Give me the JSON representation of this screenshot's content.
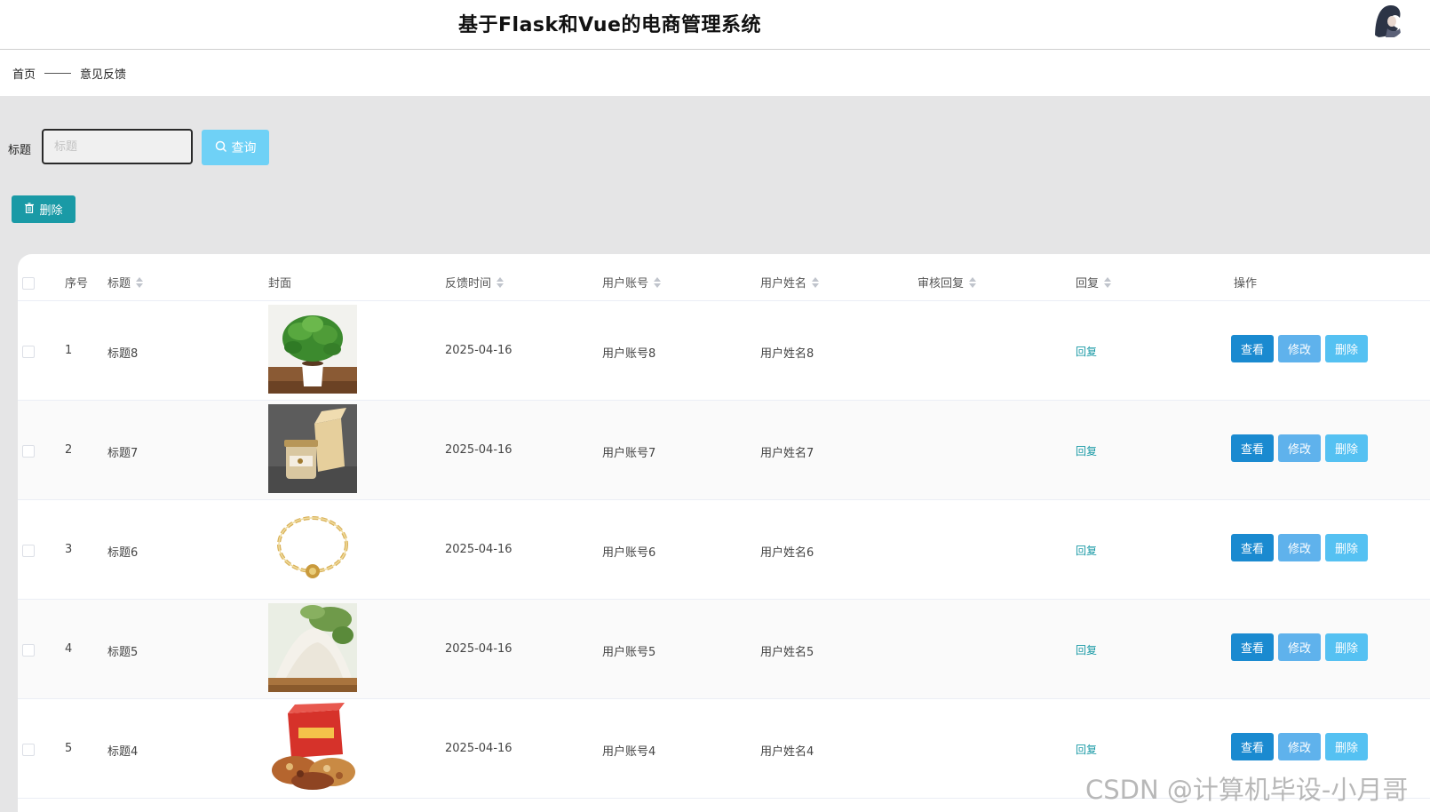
{
  "header": {
    "title": "基于Flask和Vue的电商管理系统",
    "avatar_icon": "user-avatar"
  },
  "breadcrumb": {
    "home": "首页",
    "current": "意见反馈"
  },
  "search": {
    "label": "标题",
    "placeholder": "标题",
    "value": "",
    "query_label": "查询"
  },
  "toolbar": {
    "delete_label": "删除"
  },
  "table": {
    "columns": {
      "index": "序号",
      "title": "标题",
      "cover": "封面",
      "time": "反馈时间",
      "account": "用户账号",
      "name": "用户姓名",
      "audit_reply": "审核回复",
      "reply": "回复",
      "actions": "操作"
    },
    "rows": [
      {
        "index": "1",
        "title": "标题8",
        "cover": "potted-plant",
        "time": "2025-04-16",
        "account": "用户账号8",
        "name": "用户姓名8",
        "audit_reply": "",
        "reply": "回复",
        "view": "查看",
        "edit": "修改",
        "del": "删除"
      },
      {
        "index": "2",
        "title": "标题7",
        "cover": "honey-jar-gift-box",
        "time": "2025-04-16",
        "account": "用户账号7",
        "name": "用户姓名7",
        "audit_reply": "",
        "reply": "回复",
        "view": "查看",
        "edit": "修改",
        "del": "删除"
      },
      {
        "index": "3",
        "title": "标题6",
        "cover": "gold-bracelet",
        "time": "2025-04-16",
        "account": "用户账号6",
        "name": "用户姓名6",
        "audit_reply": "",
        "reply": "回复",
        "view": "查看",
        "edit": "修改",
        "del": "删除"
      },
      {
        "index": "4",
        "title": "标题5",
        "cover": "flour-pile",
        "time": "2025-04-16",
        "account": "用户账号5",
        "name": "用户姓名5",
        "audit_reply": "",
        "reply": "回复",
        "view": "查看",
        "edit": "修改",
        "del": "删除"
      },
      {
        "index": "5",
        "title": "标题4",
        "cover": "nuts-gift-box",
        "time": "2025-04-16",
        "account": "用户账号4",
        "name": "用户姓名4",
        "audit_reply": "",
        "reply": "回复",
        "view": "查看",
        "edit": "修改",
        "del": "删除"
      }
    ]
  },
  "watermark": "CSDN @计算机毕设-小月哥",
  "colors": {
    "accent_teal": "#1a9aa6",
    "view_blue": "#1a8ad0",
    "edit_blue": "#5fb2ec",
    "delete_blue": "#55c1f2",
    "query_blue": "#6fd1f6"
  }
}
